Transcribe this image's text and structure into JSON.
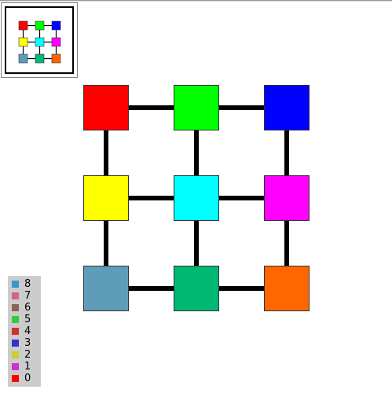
{
  "graph": {
    "rows": [
      [
        {
          "id": "n00",
          "color": "#ff0000"
        },
        {
          "id": "n01",
          "color": "#00ff00"
        },
        {
          "id": "n02",
          "color": "#0000ff"
        }
      ],
      [
        {
          "id": "n10",
          "color": "#ffff00"
        },
        {
          "id": "n11",
          "color": "#00ffff"
        },
        {
          "id": "n12",
          "color": "#ff00ff"
        }
      ],
      [
        {
          "id": "n20",
          "color": "#5f9cba"
        },
        {
          "id": "n21",
          "color": "#00b873"
        },
        {
          "id": "n22",
          "color": "#ff6600"
        }
      ]
    ]
  },
  "legend": {
    "items": [
      {
        "label": "8",
        "color": "#3399cc"
      },
      {
        "label": "7",
        "color": "#cc6688"
      },
      {
        "label": "6",
        "color": "#886655"
      },
      {
        "label": "5",
        "color": "#33cc33"
      },
      {
        "label": "4",
        "color": "#cc3333"
      },
      {
        "label": "3",
        "color": "#3333cc"
      },
      {
        "label": "2",
        "color": "#cccc33"
      },
      {
        "label": "1",
        "color": "#cc33cc"
      },
      {
        "label": "0",
        "color": "#ff0000"
      }
    ]
  }
}
